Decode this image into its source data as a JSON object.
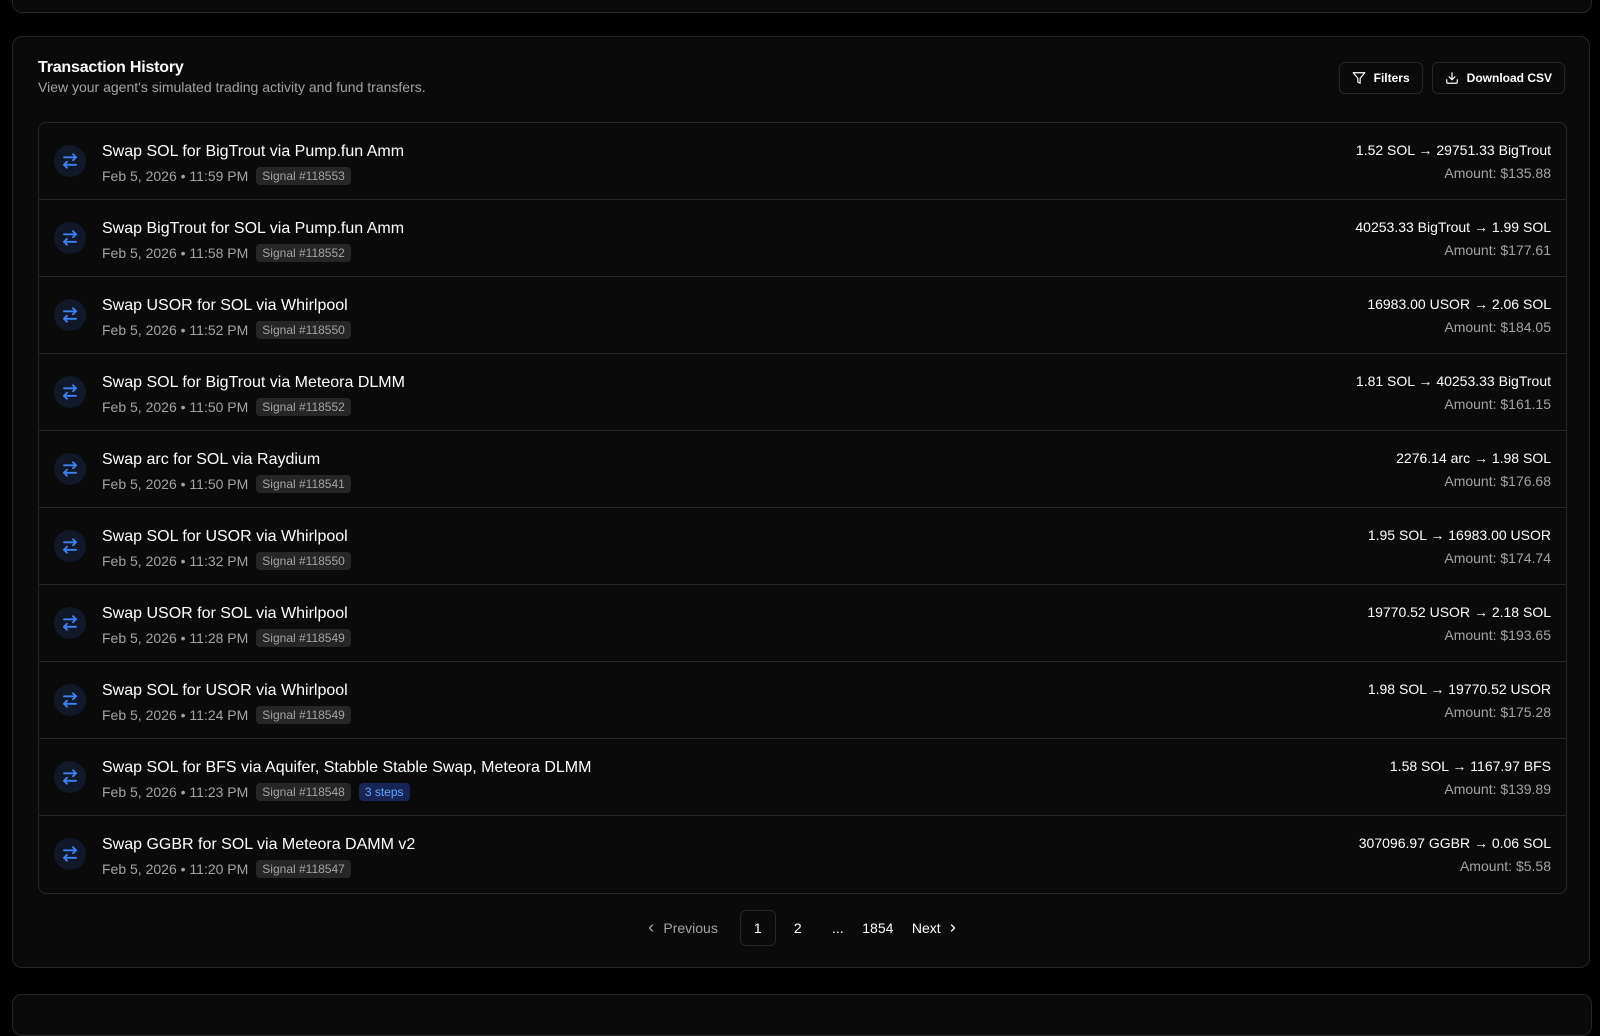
{
  "card": {
    "title": "Transaction History",
    "subtitle": "View your agent's simulated trading activity and fund transfers.",
    "filters_label": "Filters",
    "download_label": "Download CSV"
  },
  "colors": {
    "background": "#000000",
    "card": "#0a0a0a",
    "border": "#262626",
    "muted_text": "#a3a3a3",
    "icon_accent": "#3b82f6",
    "steps_badge_text": "#60a5fa"
  },
  "transactions": [
    {
      "title": "Swap SOL for BigTrout via Pump.fun Amm",
      "datetime": "Feb 5, 2026 • 11:59 PM",
      "signal": "Signal #118553",
      "steps": "",
      "swap": "1.52 SOL → 29751.33 BigTrout",
      "amount": "Amount: $135.88",
      "icon": "swap-icon"
    },
    {
      "title": "Swap BigTrout for SOL via Pump.fun Amm",
      "datetime": "Feb 5, 2026 • 11:58 PM",
      "signal": "Signal #118552",
      "steps": "",
      "swap": "40253.33 BigTrout → 1.99 SOL",
      "amount": "Amount: $177.61",
      "icon": "swap-icon"
    },
    {
      "title": "Swap USOR for SOL via Whirlpool",
      "datetime": "Feb 5, 2026 • 11:52 PM",
      "signal": "Signal #118550",
      "steps": "",
      "swap": "16983.00 USOR → 2.06 SOL",
      "amount": "Amount: $184.05",
      "icon": "swap-icon"
    },
    {
      "title": "Swap SOL for BigTrout via Meteora DLMM",
      "datetime": "Feb 5, 2026 • 11:50 PM",
      "signal": "Signal #118552",
      "steps": "",
      "swap": "1.81 SOL → 40253.33 BigTrout",
      "amount": "Amount: $161.15",
      "icon": "swap-icon"
    },
    {
      "title": "Swap arc for SOL via Raydium",
      "datetime": "Feb 5, 2026 • 11:50 PM",
      "signal": "Signal #118541",
      "steps": "",
      "swap": "2276.14 arc → 1.98 SOL",
      "amount": "Amount: $176.68",
      "icon": "swap-icon"
    },
    {
      "title": "Swap SOL for USOR via Whirlpool",
      "datetime": "Feb 5, 2026 • 11:32 PM",
      "signal": "Signal #118550",
      "steps": "",
      "swap": "1.95 SOL → 16983.00 USOR",
      "amount": "Amount: $174.74",
      "icon": "swap-icon"
    },
    {
      "title": "Swap USOR for SOL via Whirlpool",
      "datetime": "Feb 5, 2026 • 11:28 PM",
      "signal": "Signal #118549",
      "steps": "",
      "swap": "19770.52 USOR → 2.18 SOL",
      "amount": "Amount: $193.65",
      "icon": "swap-icon"
    },
    {
      "title": "Swap SOL for USOR via Whirlpool",
      "datetime": "Feb 5, 2026 • 11:24 PM",
      "signal": "Signal #118549",
      "steps": "",
      "swap": "1.98 SOL → 19770.52 USOR",
      "amount": "Amount: $175.28",
      "icon": "swap-icon"
    },
    {
      "title": "Swap SOL for BFS via Aquifer, Stabble Stable Swap, Meteora DLMM",
      "datetime": "Feb 5, 2026 • 11:23 PM",
      "signal": "Signal #118548",
      "steps": "3 steps",
      "swap": "1.58 SOL → 1167.97 BFS",
      "amount": "Amount: $139.89",
      "icon": "swap-icon"
    },
    {
      "title": "Swap GGBR for SOL via Meteora DAMM v2",
      "datetime": "Feb 5, 2026 • 11:20 PM",
      "signal": "Signal #118547",
      "steps": "",
      "swap": "307096.97 GGBR → 0.06 SOL",
      "amount": "Amount: $5.58",
      "icon": "swap-icon"
    }
  ],
  "pagination": {
    "previous_label": "Previous",
    "next_label": "Next",
    "pages": [
      "1",
      "2"
    ],
    "ellipsis": "...",
    "last_page": "1854",
    "current_page": "1"
  }
}
